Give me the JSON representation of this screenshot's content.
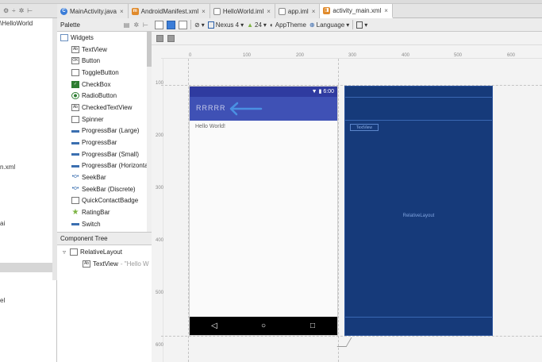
{
  "tabs": [
    {
      "label": "MainActivity.java",
      "icon": "class-icon",
      "kind": "c"
    },
    {
      "label": "AndroidManifest.xml",
      "icon": "xml-file-icon",
      "kind": "x"
    },
    {
      "label": "HelloWorld.iml",
      "icon": "module-file-icon",
      "kind": "m"
    },
    {
      "label": "app.iml",
      "icon": "module-file-icon",
      "kind": "m"
    },
    {
      "label": "activity_main.xml",
      "icon": "layout-file-icon",
      "kind": "x"
    }
  ],
  "tab_close": "×",
  "project_panel": {
    "path_fragment": "\\HelloWorld",
    "items": [
      "n.xml",
      "ai",
      "el"
    ]
  },
  "palette": {
    "title": "Palette",
    "group": "Widgets",
    "items": [
      {
        "label": "TextView",
        "icon": "Ab"
      },
      {
        "label": "Button",
        "icon": "OK"
      },
      {
        "label": "ToggleButton",
        "icon": ""
      },
      {
        "label": "CheckBox",
        "icon": "✓"
      },
      {
        "label": "RadioButton",
        "icon": ""
      },
      {
        "label": "CheckedTextView",
        "icon": "Ab"
      },
      {
        "label": "Spinner",
        "icon": ""
      },
      {
        "label": "ProgressBar (Large)",
        "icon": ""
      },
      {
        "label": "ProgressBar",
        "icon": ""
      },
      {
        "label": "ProgressBar (Small)",
        "icon": ""
      },
      {
        "label": "ProgressBar (Horizontal)",
        "icon": ""
      },
      {
        "label": "SeekBar",
        "icon": "•o•"
      },
      {
        "label": "SeekBar (Discrete)",
        "icon": "•o•"
      },
      {
        "label": "QuickContactBadge",
        "icon": ""
      },
      {
        "label": "RatingBar",
        "icon": "★"
      },
      {
        "label": "Switch",
        "icon": ""
      }
    ]
  },
  "component_tree": {
    "title": "Component Tree",
    "root": "RelativeLayout",
    "child": "TextView",
    "child_hint": "- \"Hello W"
  },
  "toolbar": {
    "device": "Nexus 4",
    "api": "24",
    "theme": "AppTheme",
    "language": "Language"
  },
  "ruler": {
    "top": [
      "0",
      "100",
      "200",
      "300",
      "400",
      "500",
      "600"
    ],
    "left": [
      "100",
      "200",
      "300",
      "400",
      "500",
      "600",
      "700"
    ]
  },
  "device": {
    "status_time": "6:00",
    "app_title": "RRRRR",
    "hello_text": "Hello World!",
    "nav_back": "◁",
    "nav_home": "○",
    "nav_recent": "□"
  },
  "blueprint": {
    "textview_label": "TextView",
    "layout_label": "RelativeLayout"
  },
  "colors": {
    "app_bar": "#3f51b5",
    "status_bar": "#2f3ba0",
    "blueprint": "#163a7a",
    "annotation_arrow": "#4a90e2"
  }
}
